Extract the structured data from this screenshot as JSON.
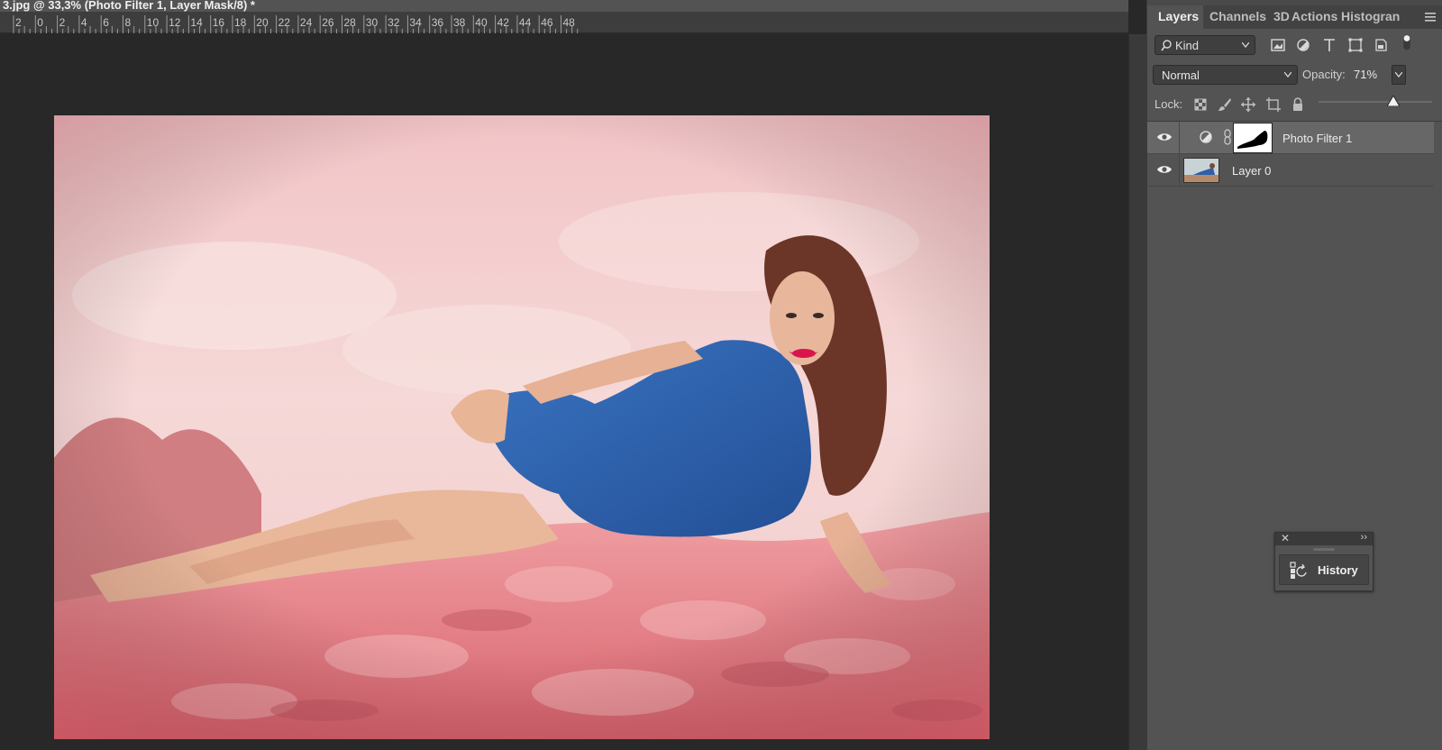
{
  "document": {
    "title": "3.jpg @ 33,3% (Photo Filter 1, Layer Mask/8) *"
  },
  "ruler": {
    "labels": [
      "2",
      "0",
      "2",
      "4",
      "6",
      "8",
      "10",
      "12",
      "14",
      "16",
      "18",
      "20",
      "22",
      "24",
      "26",
      "28",
      "30",
      "32",
      "34",
      "36",
      "38",
      "40",
      "42",
      "44",
      "46",
      "48"
    ]
  },
  "panel": {
    "tabs": [
      {
        "label": "Layers",
        "active": true
      },
      {
        "label": "Channels",
        "active": false
      },
      {
        "label": "3D",
        "active": false
      },
      {
        "label": "Actions",
        "active": false
      },
      {
        "label": "Histogran",
        "active": false
      }
    ],
    "filter": {
      "kind_label": "Kind",
      "icons": [
        "image-filter-icon",
        "adjustment-filter-icon",
        "type-filter-icon",
        "shape-filter-icon",
        "smart-object-filter-icon",
        "filter-toggle-icon"
      ]
    },
    "blend_mode": "Normal",
    "opacity_label": "Opacity:",
    "opacity_value": "71%",
    "opacity_fraction": 0.71,
    "lock_label": "Lock:",
    "lock_icons": [
      "lock-transparent-icon",
      "lock-pixels-icon",
      "lock-position-icon",
      "lock-artboard-icon",
      "lock-all-icon"
    ]
  },
  "layers": [
    {
      "name": "Photo Filter 1",
      "visible": true,
      "selected": true,
      "type": "adjustment"
    },
    {
      "name": "Layer 0",
      "visible": true,
      "selected": false,
      "type": "pixel"
    }
  ],
  "history_panel": {
    "close": "✕",
    "collapse": "››",
    "label": "History"
  },
  "colors": {
    "panel_bg": "#535353",
    "canvas_bg": "#282828",
    "selected_layer": "#676767",
    "photo_tint": "#e88a8f",
    "dress": "#2f63ae"
  }
}
